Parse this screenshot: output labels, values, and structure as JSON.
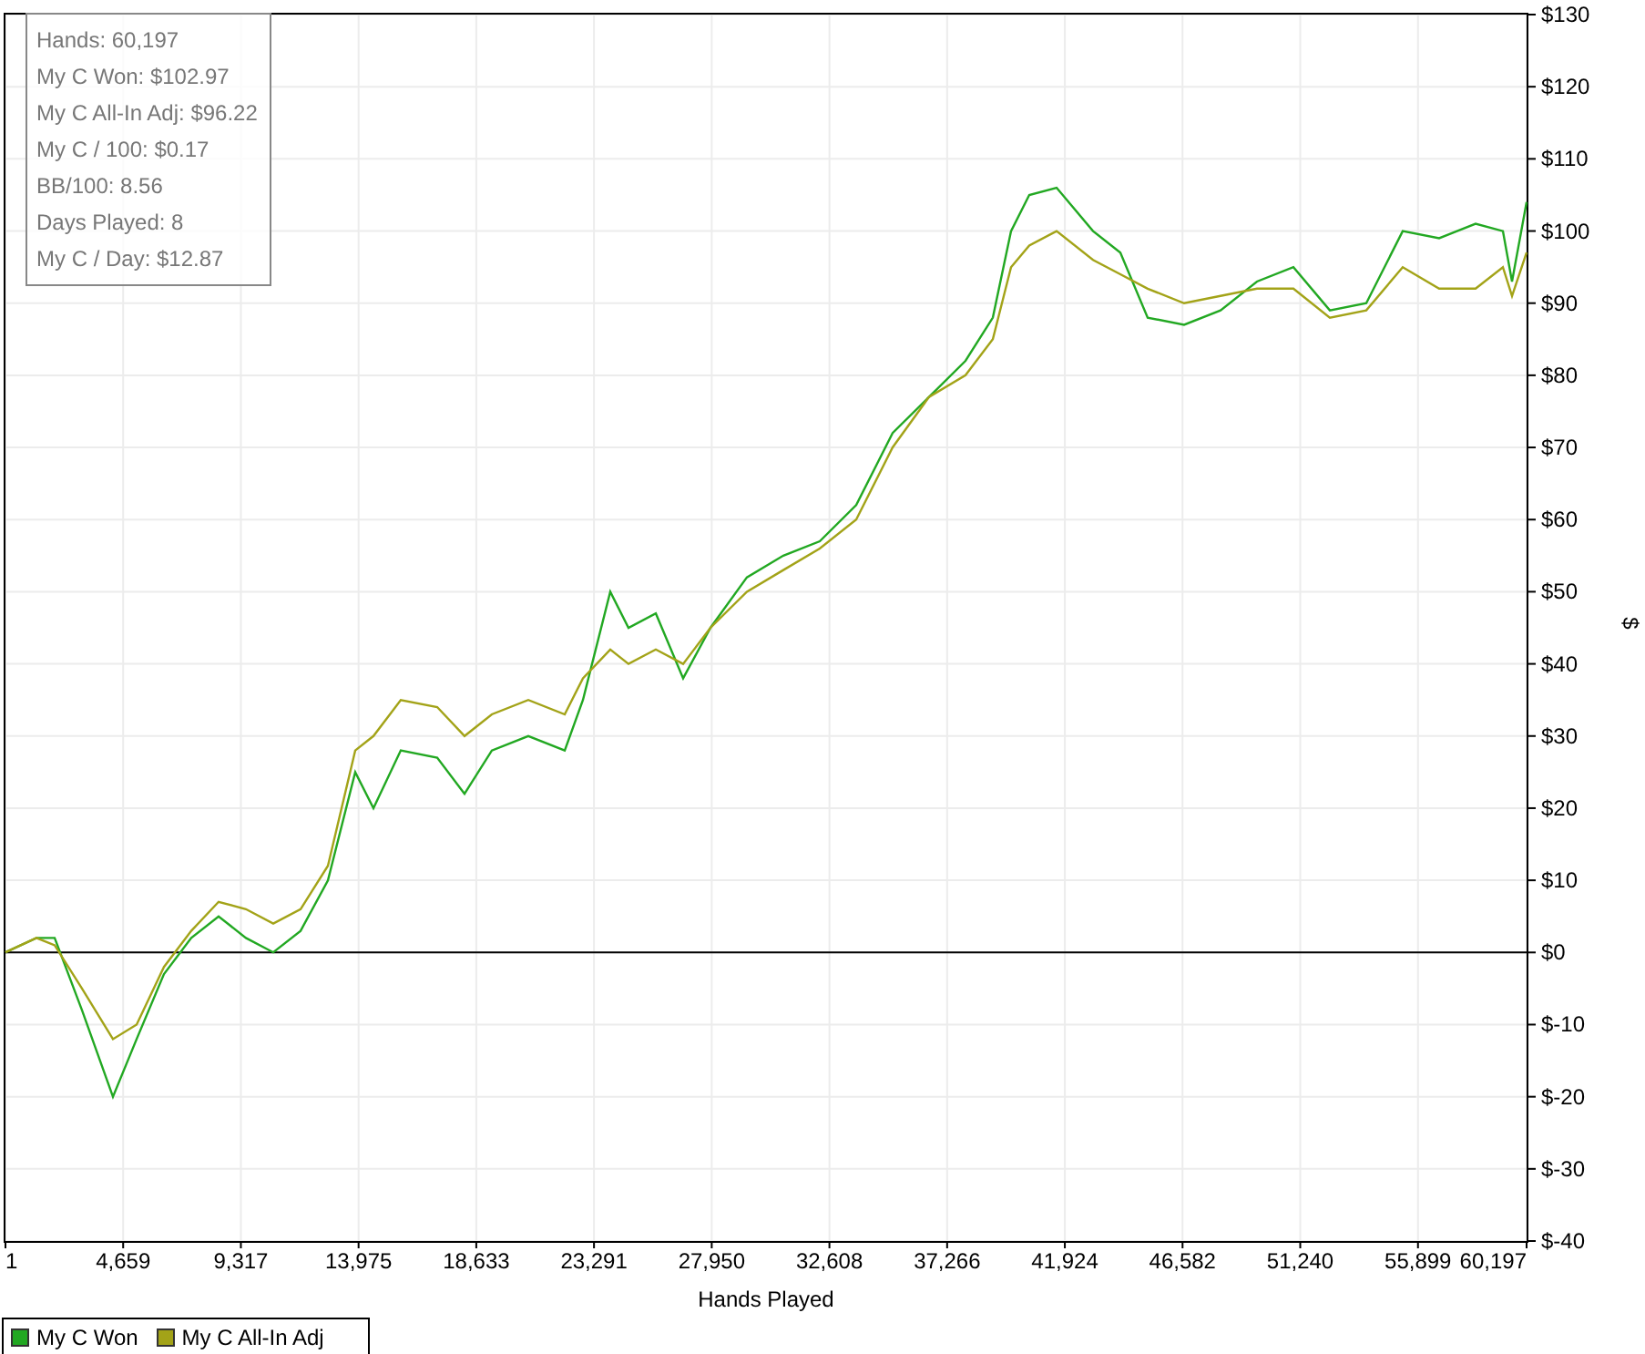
{
  "stats_box": {
    "lines": [
      "Hands: 60,197",
      "My C Won: $102.97",
      "My C All-In Adj: $96.22",
      "My C / 100: $0.17",
      "BB/100: 8.56",
      "Days Played: 8",
      "My C / Day: $12.87"
    ]
  },
  "chart_data": {
    "type": "line",
    "xlabel": "Hands Played",
    "ylabel": "$",
    "x": [
      1,
      1226,
      1946,
      3028,
      4253,
      5191,
      6272,
      7353,
      8435,
      9516,
      10597,
      11678,
      12760,
      13841,
      14562,
      15644,
      17085,
      18167,
      19248,
      20690,
      22132,
      22853,
      23934,
      24655,
      25736,
      26817,
      27899,
      29341,
      30782,
      32224,
      33666,
      35108,
      36550,
      37991,
      39073,
      39794,
      40515,
      41596,
      43038,
      44119,
      45200,
      46642,
      48084,
      49526,
      50968,
      52409,
      53851,
      55293,
      56735,
      58177,
      59258,
      59618,
      60197
    ],
    "series": [
      {
        "name": "My C Won",
        "color": "#22a822",
        "values": [
          0,
          2,
          2,
          -8,
          -20,
          -12,
          -3,
          2,
          5,
          2,
          0,
          3,
          10,
          25,
          20,
          28,
          27,
          22,
          28,
          30,
          28,
          35,
          50,
          45,
          47,
          38,
          45,
          52,
          55,
          57,
          62,
          72,
          77,
          82,
          88,
          100,
          105,
          106,
          100,
          97,
          88,
          87,
          89,
          93,
          95,
          89,
          90,
          100,
          99,
          101,
          100,
          93,
          104
        ]
      },
      {
        "name": "My C All-In Adj",
        "color": "#a3a318",
        "values": [
          0,
          2,
          1,
          -5,
          -12,
          -10,
          -2,
          3,
          7,
          6,
          4,
          6,
          12,
          28,
          30,
          35,
          34,
          30,
          33,
          35,
          33,
          38,
          42,
          40,
          42,
          40,
          45,
          50,
          53,
          56,
          60,
          70,
          77,
          80,
          85,
          95,
          98,
          100,
          96,
          94,
          92,
          90,
          91,
          92,
          92,
          88,
          89,
          95,
          92,
          92,
          95,
          91,
          97
        ]
      }
    ],
    "grid": true,
    "xlim": [
      1,
      60197
    ],
    "ylim": [
      -40,
      130
    ],
    "xticks": [
      {
        "value": 1,
        "label": "1"
      },
      {
        "value": 4659,
        "label": "4,659"
      },
      {
        "value": 9317,
        "label": "9,317"
      },
      {
        "value": 13975,
        "label": "13,975"
      },
      {
        "value": 18633,
        "label": "18,633"
      },
      {
        "value": 23291,
        "label": "23,291"
      },
      {
        "value": 27950,
        "label": "27,950"
      },
      {
        "value": 32608,
        "label": "32,608"
      },
      {
        "value": 37266,
        "label": "37,266"
      },
      {
        "value": 41924,
        "label": "41,924"
      },
      {
        "value": 46582,
        "label": "46,582"
      },
      {
        "value": 51240,
        "label": "51,240"
      },
      {
        "value": 55899,
        "label": "55,899"
      },
      {
        "value": 60197,
        "label": "60,197"
      }
    ],
    "yticks": [
      {
        "value": 130,
        "label": "$130"
      },
      {
        "value": 120,
        "label": "$120"
      },
      {
        "value": 110,
        "label": "$110"
      },
      {
        "value": 100,
        "label": "$100"
      },
      {
        "value": 90,
        "label": "$90"
      },
      {
        "value": 80,
        "label": "$80"
      },
      {
        "value": 70,
        "label": "$70"
      },
      {
        "value": 60,
        "label": "$60"
      },
      {
        "value": 50,
        "label": "$50"
      },
      {
        "value": 40,
        "label": "$40"
      },
      {
        "value": 30,
        "label": "$30"
      },
      {
        "value": 20,
        "label": "$20"
      },
      {
        "value": 10,
        "label": "$10"
      },
      {
        "value": 0,
        "label": "$0"
      },
      {
        "value": -10,
        "label": "$-10"
      },
      {
        "value": -20,
        "label": "$-20"
      },
      {
        "value": -30,
        "label": "$-30"
      },
      {
        "value": -40,
        "label": "$-40"
      }
    ]
  }
}
